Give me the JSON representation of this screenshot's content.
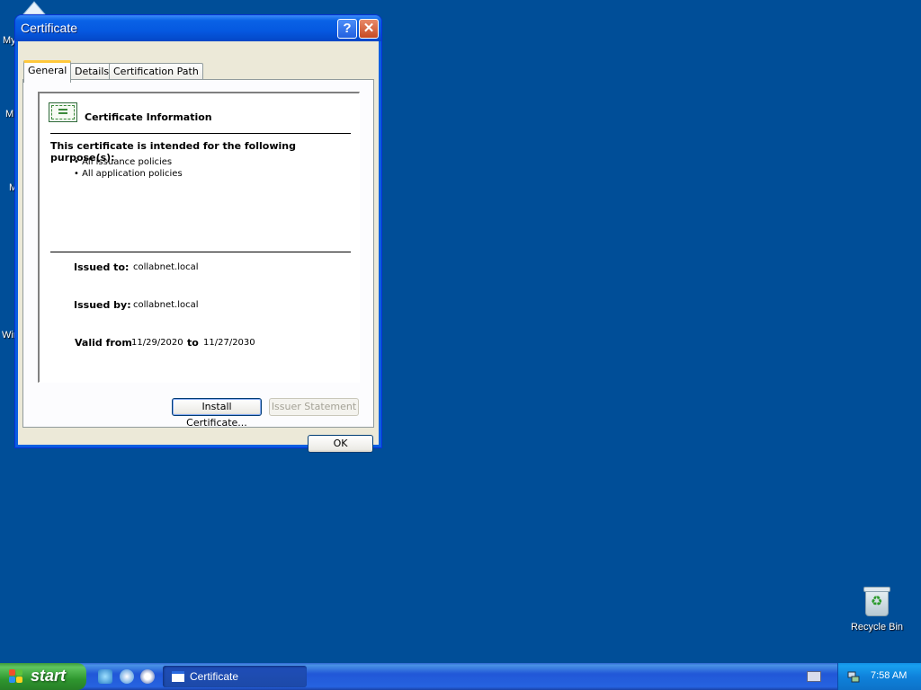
{
  "colors": {
    "desktop": "#004e98",
    "titlebar": "#0558e0",
    "dialog_face": "#ece9d8",
    "active_tab_accent": "#ffc83c",
    "start_green": "#3c9a3c",
    "tray_blue": "#0f82db"
  },
  "desktop": {
    "partial_labels": [
      "My",
      "M",
      "M",
      "Wir"
    ],
    "recycle_bin": {
      "label": "Recycle Bin",
      "icon": "recycle-bin-icon"
    }
  },
  "window": {
    "title": "Certificate",
    "help_glyph": "?",
    "close_glyph": "✕",
    "tabs": [
      {
        "label": "General",
        "active": true
      },
      {
        "label": "Details",
        "active": false
      },
      {
        "label": "Certification Path",
        "active": false
      }
    ],
    "general": {
      "info_title": "Certificate Information",
      "purpose_heading": "This certificate is intended for the following purpose(s):",
      "purposes": [
        "• All issuance policies",
        "• All application policies"
      ],
      "issued_to_label": "Issued to:",
      "issued_to": "collabnet.local",
      "issued_by_label": "Issued by:",
      "issued_by": "collabnet.local",
      "valid_from_label": "Valid from",
      "valid_from": "11/29/2020",
      "valid_to_label": "to",
      "valid_to": "11/27/2030"
    },
    "buttons": {
      "install": "Install Certificate...",
      "issuer_statement": "Issuer Statement",
      "ok": "OK"
    }
  },
  "taskbar": {
    "start_label": "start",
    "quick_launch": [
      "messenger-icon",
      "internet-explorer-icon",
      "media-player-icon"
    ],
    "tasks": [
      {
        "label": "Certificate",
        "icon": "window-icon"
      }
    ],
    "clock": "7:58 AM"
  }
}
